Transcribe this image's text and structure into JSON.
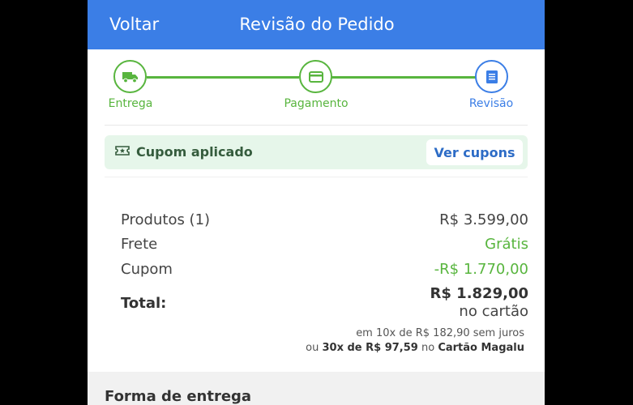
{
  "header": {
    "back_label": "Voltar",
    "title": "Revisão do Pedido"
  },
  "stepper": {
    "steps": [
      {
        "label": "Entrega",
        "icon": "truck-icon",
        "state": "done"
      },
      {
        "label": "Pagamento",
        "icon": "card-icon",
        "state": "done"
      },
      {
        "label": "Revisão",
        "icon": "document-icon",
        "state": "active"
      }
    ],
    "colors": {
      "done": "#58b53e",
      "active": "#3b7ee6"
    }
  },
  "coupon": {
    "icon": "ticket-icon",
    "text": "Cupom aplicado",
    "button_label": "Ver cupons"
  },
  "summary": {
    "products_label": "Produtos (1)",
    "products_value": "R$ 3.599,00",
    "shipping_label": "Frete",
    "shipping_value": "Grátis",
    "coupon_label": "Cupom",
    "coupon_value": "-R$ 1.770,00",
    "total_label": "Total:",
    "total_value": "R$ 1.829,00",
    "total_suffix": "no cartão",
    "installments_line": "em 10x de R$ 182,90 sem juros",
    "magalu_prefix": "ou",
    "magalu_installments": "30x de R$ 97,59",
    "magalu_mid": "no",
    "magalu_card": "Cartão Magalu"
  },
  "delivery": {
    "title": "Forma de entrega"
  }
}
